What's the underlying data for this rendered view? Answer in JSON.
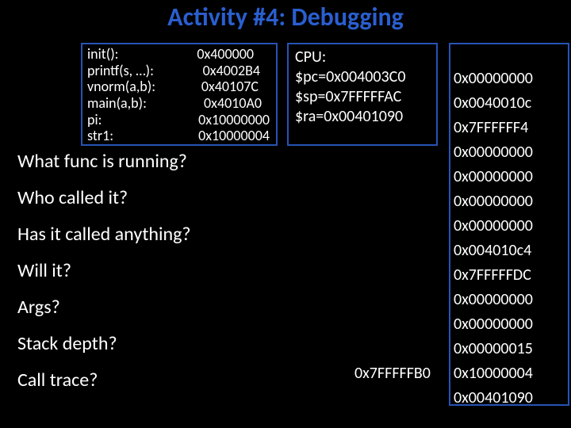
{
  "title": "Activity #4: Debugging",
  "symbols": [
    {
      "k": "init():",
      "v": "0x400000"
    },
    {
      "k": "printf(s, …):",
      "v": "0x4002B4"
    },
    {
      "k": "vnorm(a,b):",
      "v": "0x40107C"
    },
    {
      "k": "main(a,b):",
      "v": "0x4010A0"
    },
    {
      "k": "pi:",
      "v": "0x10000000"
    },
    {
      "k": "str1:",
      "v": "0x10000004"
    }
  ],
  "cpu": {
    "head": "CPU:",
    "pc": "$pc=0x004003C0",
    "sp": "$sp=0x7FFFFFAC",
    "ra": "$ra=0x00401090"
  },
  "stack_label": "0x7FFFFFB0",
  "stack": [
    "0x00000000",
    "0x0040010c",
    "0x7FFFFFF4",
    "0x00000000",
    "0x00000000",
    "0x00000000",
    "0x00000000",
    "0x004010c4",
    "0x7FFFFFDC",
    "0x00000000",
    "0x00000000",
    "0x00000015",
    "0x10000004",
    "0x00401090"
  ],
  "questions": [
    "What func is running?",
    "Who called it?",
    "Has it called anything?",
    "Will it?",
    "Args?",
    "Stack depth?",
    "Call trace?"
  ]
}
